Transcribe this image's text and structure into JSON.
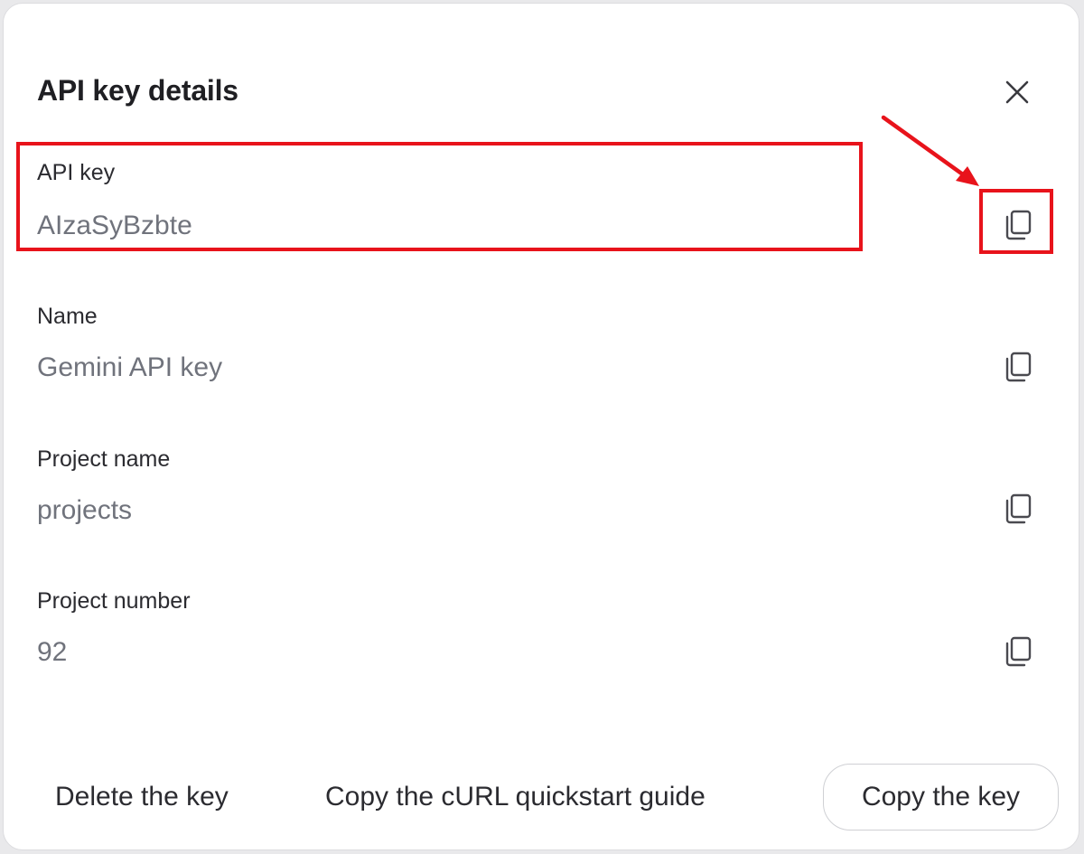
{
  "dialog": {
    "title": "API key details",
    "close_icon": "close-icon"
  },
  "fields": [
    {
      "label": "API key",
      "value": "AIzaSyBzbte",
      "icon": "copy-icon"
    },
    {
      "label": "Name",
      "value": "Gemini API key",
      "icon": "copy-icon"
    },
    {
      "label": "Project name",
      "value": "projects",
      "icon": "copy-icon"
    },
    {
      "label": "Project number",
      "value": "92",
      "icon": "copy-icon"
    }
  ],
  "footer": {
    "delete_label": "Delete the key",
    "curl_label": "Copy the cURL quickstart guide",
    "copy_key_label": "Copy the key"
  },
  "colors": {
    "highlight": "#e8131b",
    "text_primary": "#2b2b30",
    "text_secondary": "#70737c"
  }
}
